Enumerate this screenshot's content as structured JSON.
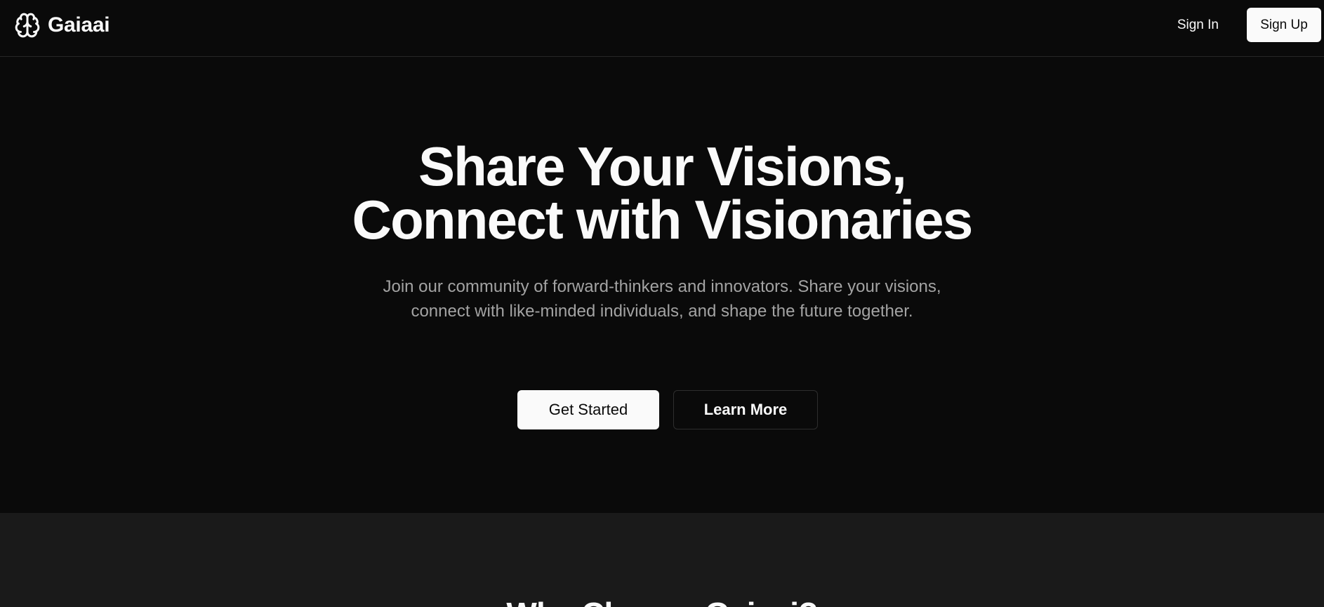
{
  "navbar": {
    "brand": {
      "name": "Gaiaai",
      "icon": "brain-icon"
    },
    "sign_in_label": "Sign In",
    "sign_up_label": "Sign Up"
  },
  "hero": {
    "title_line1": "Share Your Visions,",
    "title_line2": "Connect with Visionaries",
    "subtitle": "Join our community of forward-thinkers and innovators. Share your visions, connect with like-minded individuals, and shape the future together.",
    "primary_cta": "Get Started",
    "secondary_cta": "Learn More"
  },
  "features": {
    "title": "Why Choose Gaiaai?"
  },
  "colors": {
    "background": "#0a0a0a",
    "section_background": "#1a1a1a",
    "foreground": "#fafafa",
    "muted_text": "#a3a3a3",
    "border": "#262626"
  }
}
